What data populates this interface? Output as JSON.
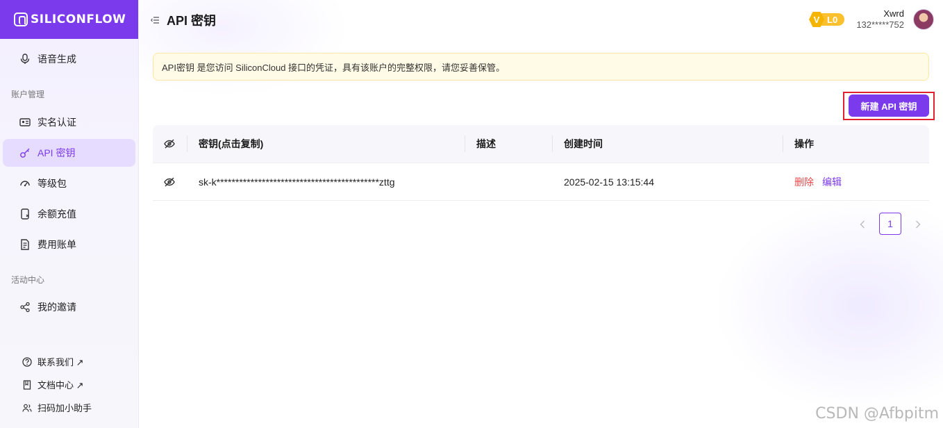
{
  "app": {
    "brand": "SILICONFLOW"
  },
  "sidebar": {
    "items": [
      {
        "label": "语音生成",
        "icon": "microphone-icon"
      },
      {
        "label": "实名认证",
        "icon": "id-card-icon"
      },
      {
        "label": "API 密钥",
        "icon": "key-icon",
        "active": true
      },
      {
        "label": "等级包",
        "icon": "gauge-icon"
      },
      {
        "label": "余额充值",
        "icon": "recharge-icon"
      },
      {
        "label": "费用账单",
        "icon": "bill-icon"
      },
      {
        "label": "我的邀请",
        "icon": "share-icon"
      }
    ],
    "sections": {
      "account": "账户管理",
      "activity": "活动中心"
    },
    "footer": [
      {
        "label": "联系我们 ↗",
        "icon": "help-icon"
      },
      {
        "label": "文档中心 ↗",
        "icon": "book-icon"
      },
      {
        "label": "扫码加小助手",
        "icon": "users-icon"
      }
    ]
  },
  "header": {
    "title": "API 密钥",
    "level": {
      "badge": "V",
      "label": "L0"
    },
    "user": {
      "name": "Xwrd",
      "phone": "132*****752"
    }
  },
  "alert": {
    "text": "API密钥 是您访问 SiliconCloud 接口的凭证，具有该账户的完整权限，请您妥善保管。"
  },
  "actions": {
    "create_label": "新建 API 密钥"
  },
  "table": {
    "columns": [
      "密钥(点击复制)",
      "描述",
      "创建时间",
      "操作"
    ],
    "rows": [
      {
        "key": "sk-k*******************************************zttg",
        "description": "",
        "created": "2025-02-15 13:15:44",
        "delete_label": "删除",
        "edit_label": "编辑"
      }
    ]
  },
  "pagination": {
    "current": "1"
  },
  "watermark": "CSDN @Afbpitm",
  "colors": {
    "accent": "#7c3aed",
    "danger": "#e8484b",
    "alert_bg": "#fffbe6",
    "level": "#fbc02d"
  }
}
